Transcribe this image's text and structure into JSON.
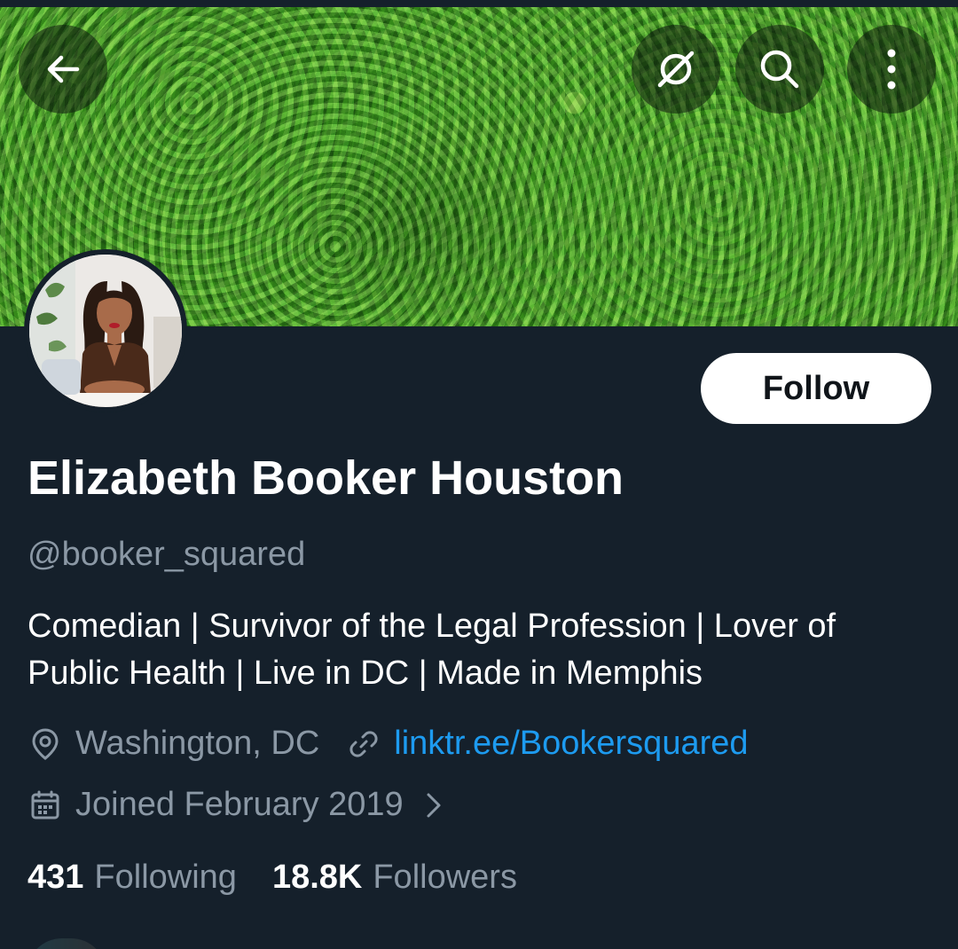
{
  "profile": {
    "display_name": "Elizabeth Booker Houston",
    "handle": "@booker_squared",
    "bio": "Comedian | Survivor of the Legal Profession | Lover of Public Health | Live in DC | Made in Memphis",
    "location": "Washington, DC",
    "website": "linktr.ee/Bookersquared",
    "joined": "Joined February 2019"
  },
  "actions": {
    "follow_label": "Follow"
  },
  "stats": {
    "following_count": "431",
    "following_label": "Following",
    "followers_count": "18.8K",
    "followers_label": "Followers"
  },
  "icons": {
    "back": "arrow-left-icon",
    "grok": "grok-icon",
    "search": "search-icon",
    "more": "more-vertical-icon",
    "location": "location-pin-icon",
    "link": "link-icon",
    "calendar": "calendar-icon",
    "chevron": "chevron-right-icon"
  },
  "colors": {
    "background": "#15202b",
    "text_primary": "#ffffff",
    "text_secondary": "#8b98a5",
    "link": "#1d9bf0",
    "follow_button_bg": "#ffffff",
    "follow_button_text": "#0f1419"
  }
}
